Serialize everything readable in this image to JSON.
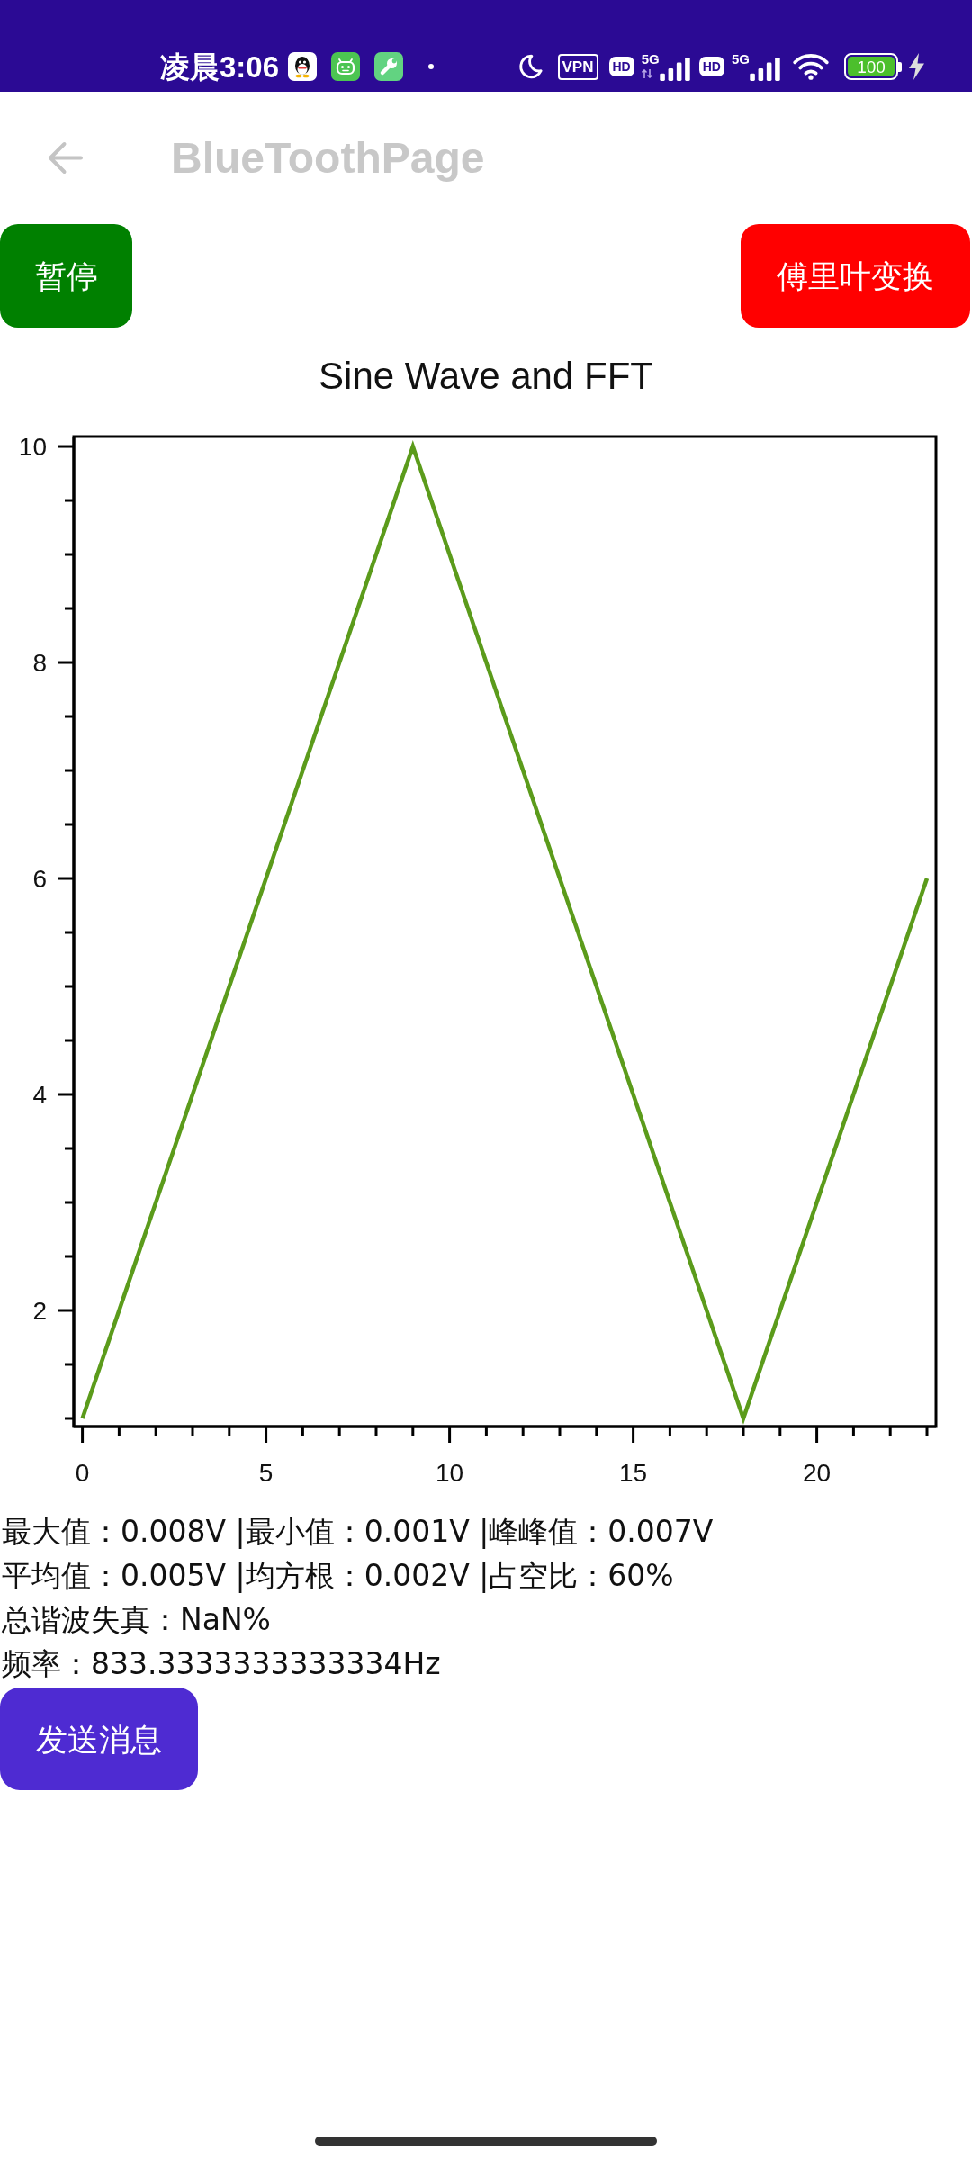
{
  "status_bar": {
    "time": "凌晨3:06",
    "vpn": "VPN",
    "networks": [
      {
        "hd": "HD",
        "type": "5G",
        "data_activity": true
      },
      {
        "hd": "HD",
        "type": "5G",
        "data_activity": false
      }
    ],
    "battery": "100"
  },
  "app_bar": {
    "title": "BlueToothPage"
  },
  "actions": [
    {
      "label": "暂停",
      "color": "#008000"
    },
    {
      "label": "傅里叶变换",
      "color": "#ff0000"
    }
  ],
  "chart": {
    "chart_data": {
      "type": "line",
      "title": "Sine Wave and FFT",
      "x": [
        0,
        1,
        2,
        3,
        4,
        5,
        6,
        7,
        8,
        9,
        10,
        11,
        12,
        13,
        14,
        15,
        16,
        17,
        18,
        19,
        20,
        21,
        22,
        23
      ],
      "series": [
        {
          "color": "#5b9b1b",
          "values": [
            1,
            2,
            3,
            4,
            5,
            6,
            7,
            8,
            9,
            10,
            9,
            8,
            7,
            6,
            5,
            4,
            3,
            2,
            1,
            2,
            3,
            4,
            5,
            6
          ]
        }
      ],
      "xlim": [
        -0.235,
        23.245
      ],
      "ylim": [
        0.925,
        10.092
      ],
      "xticks": [
        0,
        5,
        10,
        15,
        20
      ],
      "yticks": [
        2,
        4,
        6,
        8,
        10
      ]
    }
  },
  "stats": [
    "最大值：0.008V |最小值：0.001V |峰峰值：0.007V",
    "平均值：0.005V |均方根：0.002V |占空比：60%",
    "总谐波失真：NaN%",
    "频率：833.3333333333334Hz"
  ],
  "send_button": {
    "label": "发送消息"
  }
}
